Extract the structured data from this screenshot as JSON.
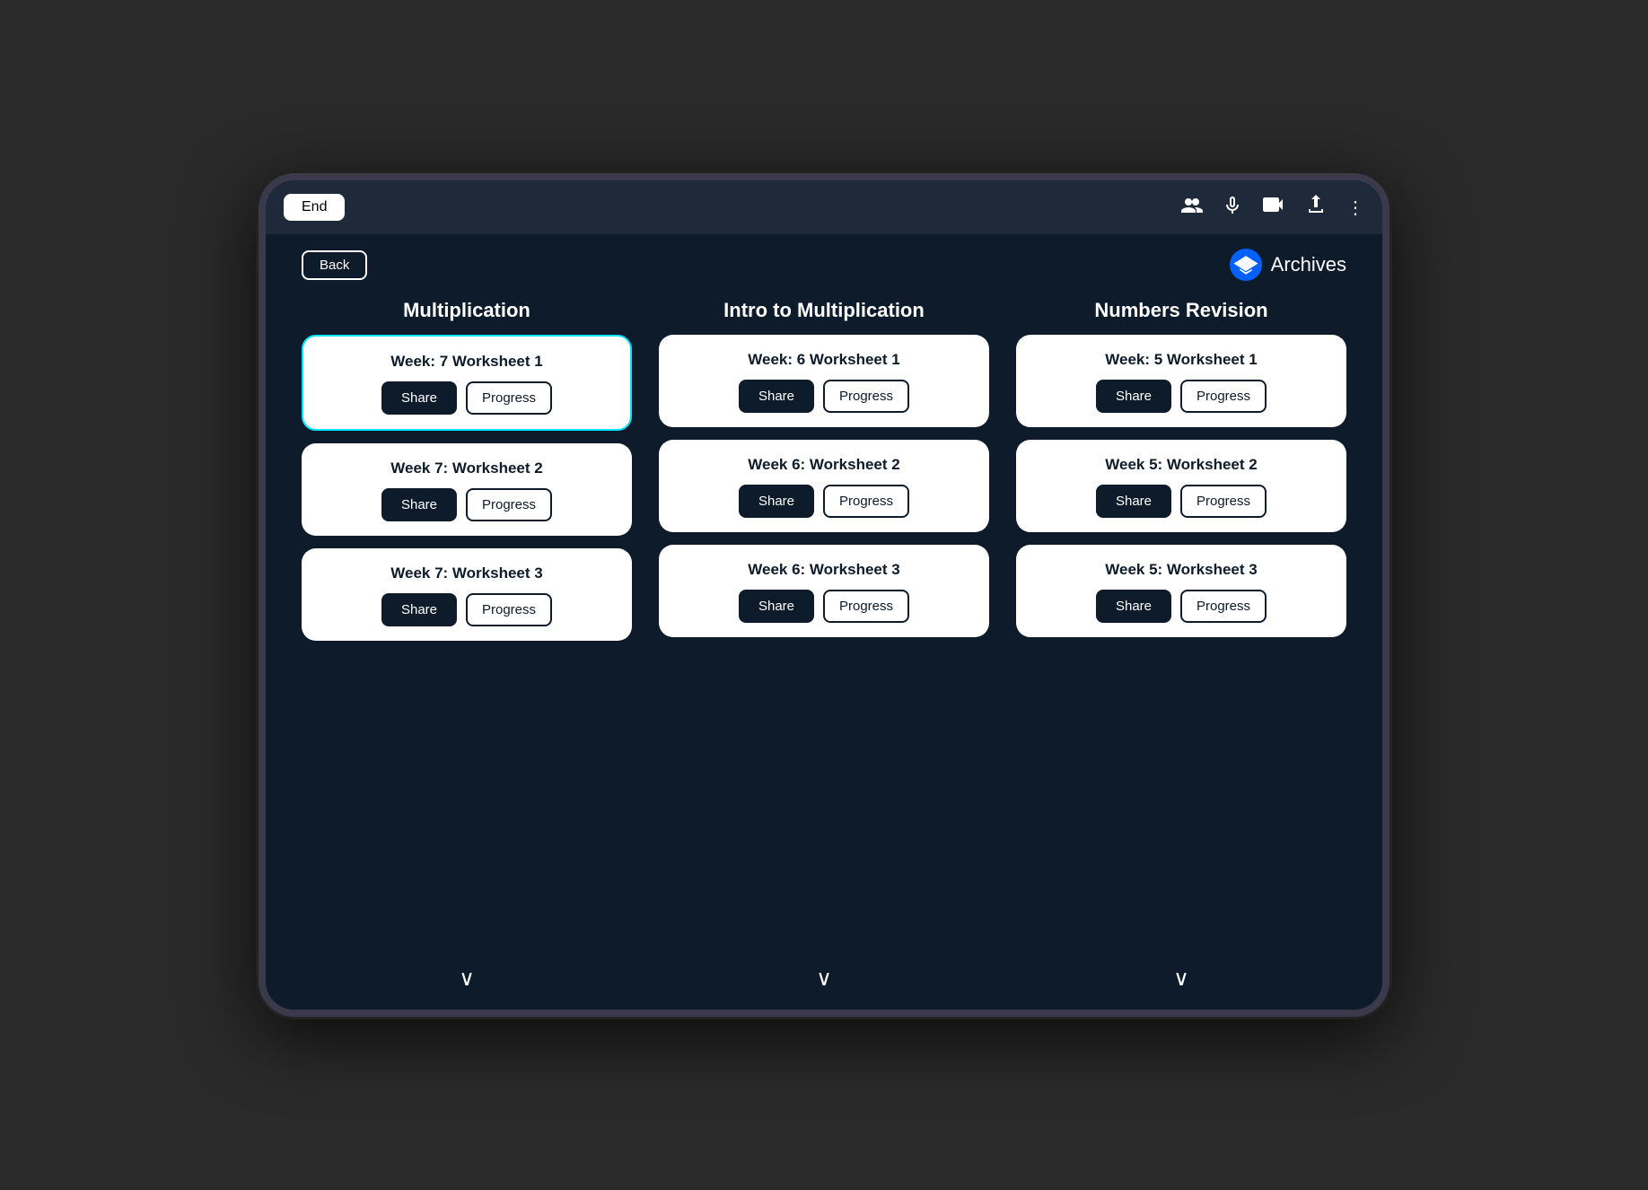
{
  "system_bar": {
    "end_label": "End",
    "icons": {
      "people": "👥",
      "mic": "🎤",
      "camera": "📹",
      "share": "⬆",
      "more": "⋮"
    }
  },
  "nav": {
    "back_label": "Back",
    "archives_label": "Archives"
  },
  "columns": [
    {
      "id": "multiplication",
      "title": "Multiplication",
      "worksheets": [
        {
          "id": "w1",
          "title": "Week: 7 Worksheet 1",
          "highlighted": true
        },
        {
          "id": "w2",
          "title": "Week 7: Worksheet 2",
          "highlighted": false
        },
        {
          "id": "w3",
          "title": "Week 7: Worksheet 3",
          "highlighted": false
        }
      ]
    },
    {
      "id": "intro-multiplication",
      "title": "Intro to Multiplication",
      "worksheets": [
        {
          "id": "w1",
          "title": "Week: 6 Worksheet 1",
          "highlighted": false
        },
        {
          "id": "w2",
          "title": "Week 6: Worksheet 2",
          "highlighted": false
        },
        {
          "id": "w3",
          "title": "Week 6: Worksheet 3",
          "highlighted": false
        }
      ]
    },
    {
      "id": "numbers-revision",
      "title": "Numbers Revision",
      "worksheets": [
        {
          "id": "w1",
          "title": "Week: 5 Worksheet 1",
          "highlighted": false
        },
        {
          "id": "w2",
          "title": "Week 5: Worksheet 2",
          "highlighted": false
        },
        {
          "id": "w3",
          "title": "Week 5: Worksheet 3",
          "highlighted": false
        }
      ]
    }
  ],
  "buttons": {
    "share_label": "Share",
    "progress_label": "Progress"
  },
  "chevron_down": "∨",
  "next_arrow": "›"
}
